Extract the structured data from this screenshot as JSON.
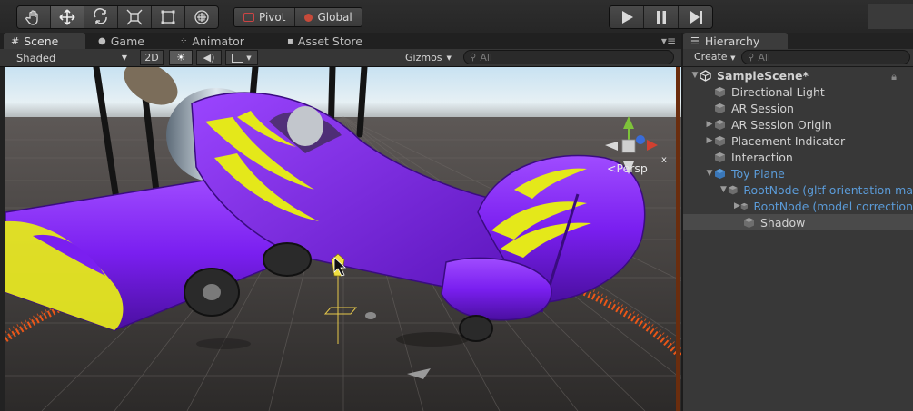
{
  "toolbar": {
    "tools": [
      "hand-icon",
      "move-icon",
      "rotate-icon",
      "scale-icon",
      "rect-icon",
      "transform-icon"
    ],
    "pivot_label": "Pivot",
    "global_label": "Global",
    "play_icons": [
      "play-icon",
      "pause-icon",
      "step-icon"
    ]
  },
  "scene": {
    "tabs": [
      {
        "label": "Scene",
        "icon": "scene-icon"
      },
      {
        "label": "Game",
        "icon": "game-icon"
      },
      {
        "label": "Animator",
        "icon": "animator-icon"
      },
      {
        "label": "Asset Store",
        "icon": "asset-store-icon"
      }
    ],
    "shading_mode": "Shaded",
    "mode_2d": "2D",
    "gizmos_label": "Gizmos",
    "search_placeholder": "All",
    "projection_label": "Persp"
  },
  "hierarchy": {
    "tab_label": "Hierarchy",
    "create_label": "Create",
    "search_placeholder": "All",
    "items": [
      {
        "label": "SampleScene*",
        "depth": 0,
        "arrow": "expanded",
        "icon": "unity-scene-icon",
        "blue": false,
        "selected": false
      },
      {
        "label": "Directional Light",
        "depth": 1,
        "arrow": "none",
        "icon": "gameobject-icon",
        "blue": false,
        "selected": false
      },
      {
        "label": "AR Session",
        "depth": 1,
        "arrow": "none",
        "icon": "gameobject-icon",
        "blue": false,
        "selected": false
      },
      {
        "label": "AR Session Origin",
        "depth": 1,
        "arrow": "collapsed",
        "icon": "gameobject-icon",
        "blue": false,
        "selected": false
      },
      {
        "label": "Placement Indicator",
        "depth": 1,
        "arrow": "collapsed",
        "icon": "gameobject-icon",
        "blue": false,
        "selected": false
      },
      {
        "label": "Interaction",
        "depth": 1,
        "arrow": "none",
        "icon": "gameobject-icon",
        "blue": false,
        "selected": false
      },
      {
        "label": "Toy Plane",
        "depth": 1,
        "arrow": "expanded",
        "icon": "prefab-icon",
        "blue": true,
        "selected": false
      },
      {
        "label": "RootNode (gltf orientation ma",
        "depth": 2,
        "arrow": "expanded",
        "icon": "gameobject-icon",
        "blue": true,
        "selected": false
      },
      {
        "label": "RootNode (model correction",
        "depth": 3,
        "arrow": "collapsed",
        "icon": "gameobject-icon",
        "blue": true,
        "selected": false
      },
      {
        "label": "Shadow",
        "depth": 3,
        "arrow": "none",
        "icon": "gameobject-icon",
        "blue": false,
        "selected": true
      }
    ]
  },
  "colors": {
    "plane_purple": "#7a1ff0",
    "flame_yellow": "#e4e81a",
    "ring_orange": "#ff5a14",
    "prefab_blue": "#5b9bd8"
  }
}
